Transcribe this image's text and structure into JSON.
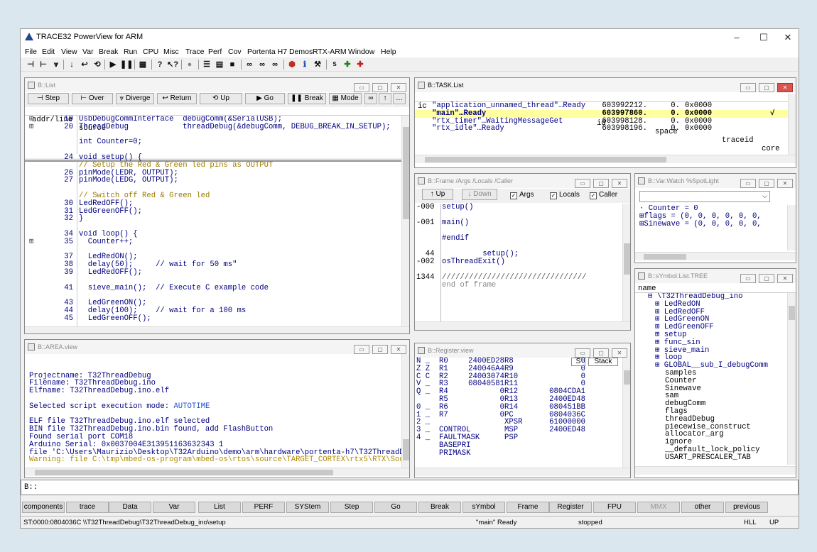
{
  "app": {
    "title": "TRACE32 PowerView for ARM",
    "min": "–",
    "max": "☐",
    "close": "✕"
  },
  "menu": [
    "File",
    "Edit",
    "View",
    "Var",
    "Break",
    "Run",
    "CPU",
    "Misc",
    "Trace",
    "Perf",
    "Cov",
    "Portenta H7 Demos",
    "RTX-ARM",
    "Window",
    "Help"
  ],
  "list_win": {
    "title": "B::List",
    "buttons": {
      "step": "Step",
      "over": "Over",
      "diverge": "Diverge",
      "return": "Return",
      "up": "Up",
      "go": "Go",
      "break": "Break",
      "mode": "Mode"
    },
    "hdr_addr": "addr/line",
    "hdr_src": "source",
    "lines": [
      {
        "plus": "⊞",
        "num": "19",
        "text": "UsbDebugCommInterface  debugComm(&SerialUSB);",
        "cls": ""
      },
      {
        "plus": "⊞",
        "num": "20",
        "text": "ThreadDebug            threadDebug(&debugComm, DEBUG_BREAK_IN_SETUP);",
        "cls": ""
      },
      {
        "plus": "",
        "num": "",
        "text": "",
        "cls": ""
      },
      {
        "plus": "",
        "num": "",
        "text": "int Counter=0;",
        "cls": ""
      },
      {
        "plus": "",
        "num": "",
        "text": "",
        "cls": ""
      },
      {
        "plus": "",
        "num": "24",
        "text": "void setup() {",
        "cls": "cur"
      },
      {
        "plus": "",
        "num": "",
        "text": "// Setup the Red & Green led pins as OUTPUT",
        "cls": "cm"
      },
      {
        "plus": "",
        "num": "26",
        "text": "pinMode(LEDR, OUTPUT);",
        "cls": ""
      },
      {
        "plus": "",
        "num": "27",
        "text": "pinMode(LEDG, OUTPUT);",
        "cls": ""
      },
      {
        "plus": "",
        "num": "",
        "text": "",
        "cls": ""
      },
      {
        "plus": "",
        "num": "",
        "text": "// Switch off Red & Green led",
        "cls": "cm"
      },
      {
        "plus": "",
        "num": "30",
        "text": "LedRedOFF();",
        "cls": ""
      },
      {
        "plus": "",
        "num": "31",
        "text": "LedGreenOFF();",
        "cls": ""
      },
      {
        "plus": "",
        "num": "32",
        "text": "}",
        "cls": ""
      },
      {
        "plus": "",
        "num": "",
        "text": "",
        "cls": ""
      },
      {
        "plus": "",
        "num": "34",
        "text": "void loop() {",
        "cls": ""
      },
      {
        "plus": "⊞",
        "num": "35",
        "text": "  Counter++;",
        "cls": ""
      },
      {
        "plus": "",
        "num": "",
        "text": "",
        "cls": ""
      },
      {
        "plus": "",
        "num": "37",
        "text": "  LedRedON();",
        "cls": ""
      },
      {
        "plus": "",
        "num": "38",
        "text": "  delay(50);     // wait for 50 ms\"",
        "cls": ""
      },
      {
        "plus": "",
        "num": "39",
        "text": "  LedRedOFF();",
        "cls": ""
      },
      {
        "plus": "",
        "num": "",
        "text": "",
        "cls": ""
      },
      {
        "plus": "",
        "num": "41",
        "text": "  sieve_main();  // Execute C example code",
        "cls": ""
      },
      {
        "plus": "",
        "num": "",
        "text": "",
        "cls": ""
      },
      {
        "plus": "",
        "num": "43",
        "text": "  LedGreenON();",
        "cls": ""
      },
      {
        "plus": "",
        "num": "44",
        "text": "  delay(100);    // wait for a 100 ms",
        "cls": ""
      },
      {
        "plus": "",
        "num": "45",
        "text": "  LedGreenOFF();",
        "cls": ""
      }
    ]
  },
  "task_win": {
    "title": "B::TASK.List",
    "headers": [
      "ic",
      "name",
      "id",
      "space",
      "traceid",
      "core"
    ],
    "rows": [
      {
        "name": "\"application_unnamed_thread\"…Ready",
        "id": "603992212.",
        "space": "0.",
        "addr": "0x0000",
        "core": "",
        "hl": false
      },
      {
        "name": "\"main\"…Ready",
        "id": "603997860.",
        "space": "0.",
        "addr": "0x0000",
        "core": "√",
        "hl": true
      },
      {
        "name": "\"rtx_timer\"…WaitingMessageGet",
        "id": "603998128.",
        "space": "0.",
        "addr": "0x0000",
        "core": "",
        "hl": false
      },
      {
        "name": "\"rtx_idle\"…Ready",
        "id": "603998196.",
        "space": "0.",
        "addr": "0x0000",
        "core": "",
        "hl": false
      }
    ]
  },
  "frame_win": {
    "title": "B::Frame /Args /Locals /Caller",
    "up": "Up",
    "down": "Down",
    "args": "Args",
    "locals": "Locals",
    "caller": "Caller",
    "lines": [
      {
        "l": "-000",
        "r": "setup()"
      },
      {
        "l": "",
        "r": ""
      },
      {
        "l": "-001",
        "r": "main()"
      },
      {
        "l": "",
        "r": ""
      },
      {
        "l": "",
        "r": "#endif"
      },
      {
        "l": "",
        "r": ""
      },
      {
        "l": "  44",
        "r": "         setup();"
      },
      {
        "l": "-002",
        "r": "osThreadExit()"
      },
      {
        "l": "",
        "r": ""
      },
      {
        "l": "1344",
        "r": "////////////////////////////////"
      },
      {
        "l": "",
        "r": "end of frame"
      }
    ]
  },
  "watch_win": {
    "title": "B::Var.Watch %SpotLight",
    "lines": [
      "· Counter = 0",
      "⊞flags = (0, 0, 0, 0, 0, 0,",
      "⊞Sinewave = (0, 0, 0, 0, 0,"
    ]
  },
  "symbol_win": {
    "title": "B::sYmbol.List.TREE",
    "hdr": "name",
    "items": [
      {
        "t": "⊟ \\T32ThreadDebug_ino",
        "ind": 0
      },
      {
        "t": "⊞ LedRedON",
        "ind": 1
      },
      {
        "t": "⊞ LedRedOFF",
        "ind": 1
      },
      {
        "t": "⊞ LedGreenON",
        "ind": 1
      },
      {
        "t": "⊞ LedGreenOFF",
        "ind": 1
      },
      {
        "t": "⊞ setup",
        "ind": 1
      },
      {
        "t": "⊞ func_sin",
        "ind": 1
      },
      {
        "t": "⊞ sieve_main",
        "ind": 1
      },
      {
        "t": "⊞ loop",
        "ind": 1
      },
      {
        "t": "⊞ GLOBAL__sub_I_debugComm",
        "ind": 1
      },
      {
        "t": "samples",
        "ind": 2
      },
      {
        "t": "Counter",
        "ind": 2
      },
      {
        "t": "Sinewave",
        "ind": 2
      },
      {
        "t": "sam",
        "ind": 2
      },
      {
        "t": "debugComm",
        "ind": 2
      },
      {
        "t": "flags",
        "ind": 2
      },
      {
        "t": "threadDebug",
        "ind": 2
      },
      {
        "t": "piecewise_construct",
        "ind": 2
      },
      {
        "t": "allocator_arg",
        "ind": 2
      },
      {
        "t": "ignore",
        "ind": 2
      },
      {
        "t": "__default_lock_policy",
        "ind": 2
      },
      {
        "t": "USART_PRESCALER_TAB",
        "ind": 2
      }
    ]
  },
  "area_win": {
    "title": "B::AREA.view",
    "lines": [
      {
        "t": "",
        "c": ""
      },
      {
        "t": "",
        "c": ""
      },
      {
        "t": "Projectname: T32ThreadDebug",
        "c": ""
      },
      {
        "t": "Filename: T32ThreadDebug.ino",
        "c": ""
      },
      {
        "t": "Elfname: T32ThreadDebug.ino.elf",
        "c": ""
      },
      {
        "t": "",
        "c": ""
      },
      {
        "t": "Selected script execution mode: ",
        "c": "",
        "x": "AUTOTIME"
      },
      {
        "t": "",
        "c": ""
      },
      {
        "t": "ELF file T32ThreadDebug.ino.elf selected",
        "c": ""
      },
      {
        "t": "BIN file T32ThreadDebug.ino.bin found, add FlashButton",
        "c": ""
      },
      {
        "t": "Found serial port COM18",
        "c": ""
      },
      {
        "t": "Arduino Serial: 0x0037004E313951163632343 1",
        "c": ""
      },
      {
        "t": "file 'C:\\Users\\Maurizio\\Desktop\\T32Arduino\\demo\\arm\\hardware\\portenta-h7\\T32ThreadD",
        "c": ""
      },
      {
        "t": "Warning: file C:\\tmp\\mbed-os-program\\mbed-os\\rtos\\source\\TARGET_CORTEX\\rtx5\\RTX\\Sou",
        "c": "warn"
      }
    ]
  },
  "reg_win": {
    "title": "B::Register.view",
    "s": "S",
    "stack": "Stack",
    "flags": [
      "N _",
      "Z Z",
      "C C",
      "V _",
      "Q _",
      "",
      "0 _",
      "1 _",
      "2 _",
      "3 _",
      "4 _"
    ],
    "regs": [
      [
        "R0",
        "2400ED28",
        "R8",
        "0"
      ],
      [
        "R1",
        "240046A4",
        "R9",
        "0"
      ],
      [
        "R2",
        "24003074",
        "R10",
        "0"
      ],
      [
        "R3",
        "08040581",
        "R11",
        "0"
      ],
      [
        "R4",
        "0",
        "R12",
        "0804CDA1"
      ],
      [
        "R5",
        "0",
        "R13",
        "2400ED48"
      ],
      [
        "R6",
        "0",
        "R14",
        "080451BB"
      ],
      [
        "R7",
        "0",
        "PC",
        "0804036C"
      ],
      [
        "",
        "",
        "XPSR",
        "61000000"
      ],
      [
        "CONTROL",
        "",
        "MSP",
        "2400ED48"
      ],
      [
        "FAULTMASK",
        "",
        "PSP",
        ""
      ],
      [
        "BASEPRI",
        "",
        "",
        ""
      ],
      [
        "PRIMASK",
        "",
        "",
        ""
      ]
    ]
  },
  "cmdline": {
    "prompt": "B::"
  },
  "bottom_buttons": [
    "components",
    "trace",
    "Data",
    "Var",
    "List",
    "PERF",
    "SYStem",
    "Step",
    "Go",
    "Break",
    "sYmbol",
    "Frame",
    "Register",
    "FPU",
    "MMX",
    "other",
    "previous"
  ],
  "status": {
    "addr": "ST:0000:0804036C  \\\\T32ThreadDebug\\T32ThreadDebug_ino\\setup",
    "task": "\"main\" Ready",
    "state": "stopped",
    "mode": "HLL",
    "up": "UP"
  }
}
